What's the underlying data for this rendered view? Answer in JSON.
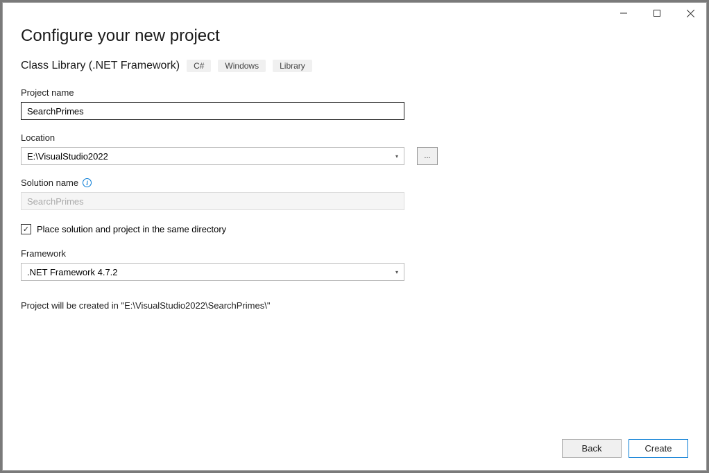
{
  "window": {
    "heading": "Configure your new project",
    "subheading": "Class Library (.NET Framework)",
    "tags": [
      "C#",
      "Windows",
      "Library"
    ]
  },
  "fields": {
    "projectName": {
      "label": "Project name",
      "value": "SearchPrimes"
    },
    "location": {
      "label": "Location",
      "value": "E:\\VisualStudio2022",
      "browseLabel": "..."
    },
    "solutionName": {
      "label": "Solution name",
      "placeholder": "SearchPrimes"
    },
    "sameDirectory": {
      "label": "Place solution and project in the same directory",
      "checked": true
    },
    "framework": {
      "label": "Framework",
      "value": ".NET Framework 4.7.2"
    },
    "preview": "Project will be created in \"E:\\VisualStudio2022\\SearchPrimes\\\""
  },
  "footer": {
    "back": "Back",
    "create": "Create"
  }
}
